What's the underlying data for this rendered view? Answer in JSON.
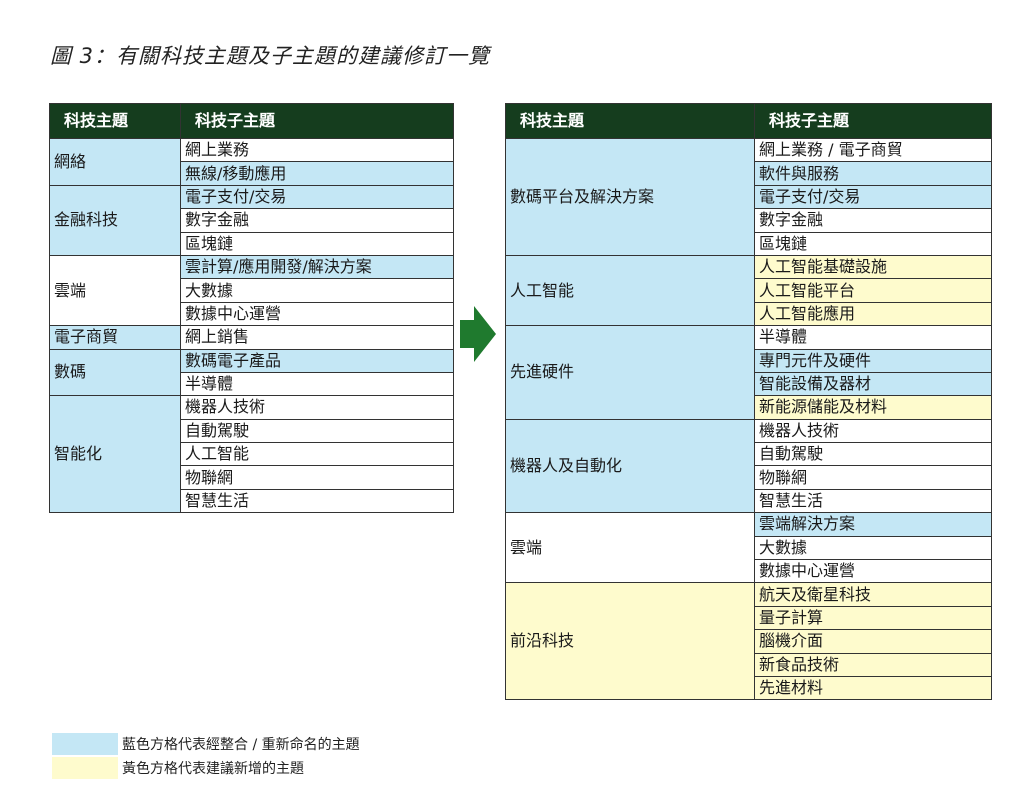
{
  "title": "圖 3：有關科技主題及子主題的建議修訂一覽",
  "colors": {
    "header": "#153d1e",
    "blue": "#c4e7f5",
    "yellow": "#fefbcd",
    "arrow": "#1f7a2e"
  },
  "left_table": {
    "headers": [
      "科技主題",
      "科技子主題"
    ],
    "groups": [
      {
        "theme": "網絡",
        "color": "blue",
        "subs": [
          {
            "label": "網上業務",
            "color": "white"
          },
          {
            "label": "無線/移動應用",
            "color": "blue"
          }
        ]
      },
      {
        "theme": "金融科技",
        "color": "blue",
        "subs": [
          {
            "label": "電子支付/交易",
            "color": "blue"
          },
          {
            "label": "數字金融",
            "color": "white"
          },
          {
            "label": "區塊鏈",
            "color": "white"
          }
        ]
      },
      {
        "theme": "雲端",
        "color": "white",
        "subs": [
          {
            "label": "雲計算/應用開發/解決方案",
            "color": "blue"
          },
          {
            "label": "大數據",
            "color": "white"
          },
          {
            "label": "數據中心運營",
            "color": "white"
          }
        ]
      },
      {
        "theme": "電子商貿",
        "color": "blue",
        "subs": [
          {
            "label": "網上銷售",
            "color": "white"
          }
        ]
      },
      {
        "theme": "數碼",
        "color": "blue",
        "subs": [
          {
            "label": "數碼電子產品",
            "color": "blue"
          },
          {
            "label": "半導體",
            "color": "white"
          }
        ]
      },
      {
        "theme": "智能化",
        "color": "blue",
        "subs": [
          {
            "label": "機器人技術",
            "color": "white"
          },
          {
            "label": "自動駕駛",
            "color": "white"
          },
          {
            "label": "人工智能",
            "color": "white"
          },
          {
            "label": "物聯網",
            "color": "white"
          },
          {
            "label": "智慧生活",
            "color": "white"
          }
        ]
      }
    ]
  },
  "right_table": {
    "headers": [
      "科技主題",
      "科技子主題"
    ],
    "groups": [
      {
        "theme": "數碼平台及解決方案",
        "color": "blue",
        "subs": [
          {
            "label": "網上業務 / 電子商貿",
            "color": "white"
          },
          {
            "label": "軟件與服務",
            "color": "blue"
          },
          {
            "label": "電子支付/交易",
            "color": "blue"
          },
          {
            "label": "數字金融",
            "color": "white"
          },
          {
            "label": "區塊鏈",
            "color": "white"
          }
        ]
      },
      {
        "theme": "人工智能",
        "color": "blue",
        "subs": [
          {
            "label": "人工智能基礎設施",
            "color": "yellow"
          },
          {
            "label": "人工智能平台",
            "color": "yellow"
          },
          {
            "label": "人工智能應用",
            "color": "yellow"
          }
        ]
      },
      {
        "theme": "先進硬件",
        "color": "blue",
        "subs": [
          {
            "label": "半導體",
            "color": "white"
          },
          {
            "label": "專門元件及硬件",
            "color": "blue"
          },
          {
            "label": "智能設備及器材",
            "color": "blue"
          },
          {
            "label": "新能源儲能及材料",
            "color": "yellow"
          }
        ]
      },
      {
        "theme": "機器人及自動化",
        "color": "blue",
        "subs": [
          {
            "label": "機器人技術",
            "color": "white"
          },
          {
            "label": "自動駕駛",
            "color": "white"
          },
          {
            "label": "物聯網",
            "color": "white"
          },
          {
            "label": "智慧生活",
            "color": "white"
          }
        ]
      },
      {
        "theme": "雲端",
        "color": "white",
        "subs": [
          {
            "label": "雲端解決方案",
            "color": "blue"
          },
          {
            "label": "大數據",
            "color": "white"
          },
          {
            "label": "數據中心運營",
            "color": "white"
          }
        ]
      },
      {
        "theme": "前沿科技",
        "color": "yellow",
        "subs": [
          {
            "label": "航天及衛星科技",
            "color": "yellow"
          },
          {
            "label": "量子計算",
            "color": "yellow"
          },
          {
            "label": "腦機介面",
            "color": "yellow"
          },
          {
            "label": "新食品技術",
            "color": "yellow"
          },
          {
            "label": "先進材料",
            "color": "yellow"
          }
        ]
      }
    ]
  },
  "legend": [
    {
      "color": "blue",
      "text": "藍色方格代表經整合 / 重新命名的主題"
    },
    {
      "color": "yellow",
      "text": "黃色方格代表建議新增的主題"
    }
  ]
}
